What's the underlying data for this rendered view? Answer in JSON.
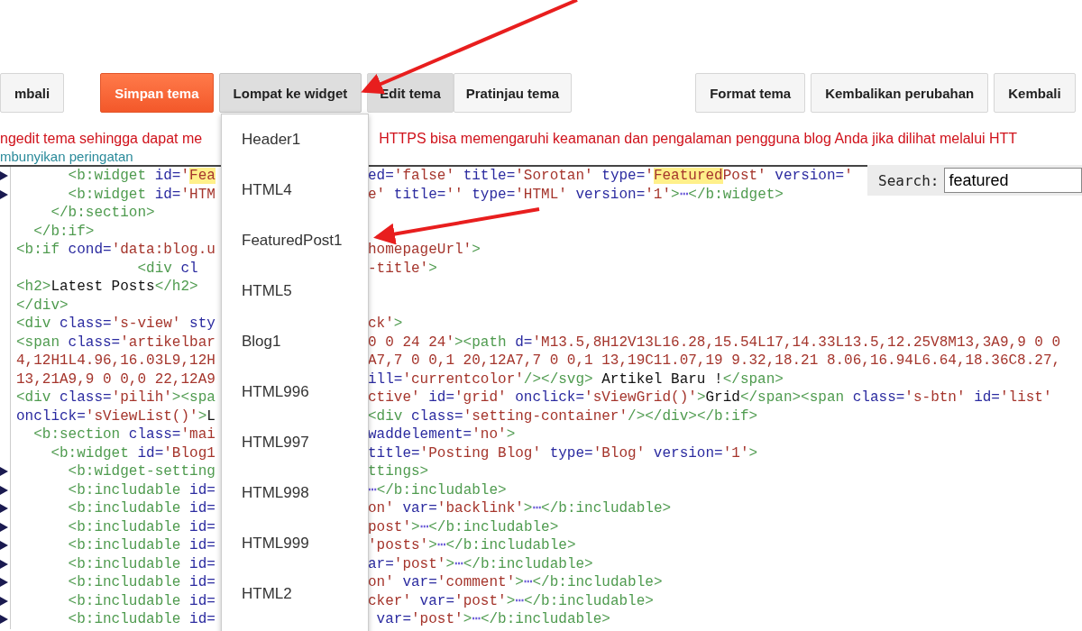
{
  "toolbar": {
    "left": [
      {
        "label": "mbali",
        "kind": "plain"
      },
      {
        "label": "Simpan tema",
        "kind": "primary"
      },
      {
        "label": "Lompat ke widget",
        "kind": "menu",
        "expanded": true
      }
    ],
    "modes": [
      {
        "label": "Edit tema",
        "selected": true
      },
      {
        "label": "Pratinjau tema",
        "selected": false
      }
    ],
    "right": [
      {
        "label": "Format tema",
        "kind": "plain"
      },
      {
        "label": "Kembalikan perubahan",
        "kind": "plain"
      },
      {
        "label": "Kembali",
        "kind": "plain"
      }
    ]
  },
  "warning": {
    "left": "ngedit tema sehingga dapat me",
    "right": "HTTPS bisa memengaruhi keamanan dan pengalaman pengguna blog Anda jika dilihat melalui HTT",
    "link": "mbunyikan peringatan"
  },
  "widget_menu": {
    "items": [
      "Header1",
      "HTML4",
      "FeaturedPost1",
      "HTML5",
      "Blog1",
      "HTML996",
      "HTML997",
      "HTML998",
      "HTML999",
      "HTML2"
    ]
  },
  "editor": {
    "lines": [
      {
        "collapsed": true,
        "left": [
          {
            "kind": "tag",
            "text": "      <b:widget "
          },
          {
            "kind": "attr",
            "text": "id="
          },
          {
            "kind": "str",
            "text": "'"
          },
          {
            "kind": "match",
            "text": "Fea"
          }
        ],
        "right": [
          {
            "kind": "attr",
            "text": "ed="
          },
          {
            "kind": "str",
            "text": "'false'"
          },
          {
            "kind": "attr",
            "text": " title="
          },
          {
            "kind": "str",
            "text": "'Sorotan'"
          },
          {
            "kind": "attr",
            "text": " type="
          },
          {
            "kind": "str",
            "text": "'"
          },
          {
            "kind": "match",
            "text": "Featured"
          },
          {
            "kind": "str",
            "text": "Post'"
          },
          {
            "kind": "attr",
            "text": " version="
          },
          {
            "kind": "str",
            "text": "'"
          }
        ]
      },
      {
        "collapsed": true,
        "left": [
          {
            "kind": "tag",
            "text": "      <b:widget "
          },
          {
            "kind": "attr",
            "text": "id="
          },
          {
            "kind": "str",
            "text": "'HTM"
          }
        ],
        "right": [
          {
            "kind": "str",
            "text": "e'"
          },
          {
            "kind": "attr",
            "text": " title="
          },
          {
            "kind": "str",
            "text": "''"
          },
          {
            "kind": "attr",
            "text": " type="
          },
          {
            "kind": "str",
            "text": "'HTML'"
          },
          {
            "kind": "attr",
            "text": " version="
          },
          {
            "kind": "str",
            "text": "'1'"
          },
          {
            "kind": "tag",
            "text": ">"
          },
          {
            "kind": "dots",
            "text": "⋯"
          },
          {
            "kind": "tag",
            "text": "</b:widget>"
          }
        ]
      },
      {
        "collapsed": false,
        "left": [
          {
            "kind": "tag",
            "text": "    </b:section>"
          }
        ]
      },
      {
        "collapsed": false,
        "left": [
          {
            "kind": "tag",
            "text": "  </b:if>"
          }
        ]
      },
      {
        "collapsed": false,
        "left": [
          {
            "kind": "tag",
            "text": "<b:if "
          },
          {
            "kind": "attr",
            "text": "cond="
          },
          {
            "kind": "str",
            "text": "'data:blog.u"
          }
        ],
        "right": [
          {
            "kind": "str",
            "text": "homepageUrl'"
          },
          {
            "kind": "tag",
            "text": ">"
          }
        ]
      },
      {
        "collapsed": false,
        "left": [
          {
            "kind": "tag",
            "text": "              <div "
          },
          {
            "kind": "attr",
            "text": "cl"
          }
        ],
        "right": [
          {
            "kind": "str",
            "text": "-title'"
          },
          {
            "kind": "tag",
            "text": ">"
          }
        ]
      },
      {
        "collapsed": false,
        "left": [
          {
            "kind": "tag",
            "text": "<h2>"
          },
          {
            "kind": "text",
            "text": "Latest Posts"
          },
          {
            "kind": "tag",
            "text": "</h2>"
          }
        ]
      },
      {
        "collapsed": false,
        "left": [
          {
            "kind": "tag",
            "text": "</div>"
          }
        ]
      },
      {
        "collapsed": false,
        "left": [
          {
            "kind": "tag",
            "text": "<div "
          },
          {
            "kind": "attr",
            "text": "class="
          },
          {
            "kind": "str",
            "text": "'s-view'"
          },
          {
            "kind": "attr",
            "text": " sty"
          }
        ],
        "right": [
          {
            "kind": "str",
            "text": "ck'"
          },
          {
            "kind": "tag",
            "text": ">"
          }
        ]
      },
      {
        "collapsed": false,
        "left": [
          {
            "kind": "tag",
            "text": "<span "
          },
          {
            "kind": "attr",
            "text": "class="
          },
          {
            "kind": "str",
            "text": "'artikelbar"
          }
        ],
        "right": [
          {
            "kind": "str",
            "text": "0 0 24 24'"
          },
          {
            "kind": "tag",
            "text": "><path "
          },
          {
            "kind": "attr",
            "text": "d="
          },
          {
            "kind": "str",
            "text": "'M13.5,8H12V13L16.28,15.54L17,14.33L13.5,12.25V8M13,3A9,9 0 0"
          }
        ]
      },
      {
        "collapsed": false,
        "left": [
          {
            "kind": "str",
            "text": "4,12H1L4.96,16.03L9,12H"
          }
        ],
        "right": [
          {
            "kind": "str",
            "text": "A7,7 0 0,1 20,12A7,7 0 0,1 13,19C11.07,19 9.32,18.21 8.06,16.94L6.64,18.36C8.27,"
          }
        ]
      },
      {
        "collapsed": false,
        "left": [
          {
            "kind": "str",
            "text": "13,21A9,9 0 0,0 22,12A9"
          }
        ],
        "right": [
          {
            "kind": "attr",
            "text": "ill="
          },
          {
            "kind": "str",
            "text": "'currentcolor'"
          },
          {
            "kind": "tag",
            "text": "/></svg>"
          },
          {
            "kind": "text",
            "text": " Artikel Baru !"
          },
          {
            "kind": "tag",
            "text": "</span>"
          }
        ]
      },
      {
        "collapsed": false,
        "left": [
          {
            "kind": "tag",
            "text": "<div "
          },
          {
            "kind": "attr",
            "text": "class="
          },
          {
            "kind": "str",
            "text": "'pilih'"
          },
          {
            "kind": "tag",
            "text": "><spa"
          }
        ],
        "right": [
          {
            "kind": "str",
            "text": "ctive'"
          },
          {
            "kind": "attr",
            "text": " id="
          },
          {
            "kind": "str",
            "text": "'grid'"
          },
          {
            "kind": "attr",
            "text": " onclick="
          },
          {
            "kind": "str",
            "text": "'sViewGrid()'"
          },
          {
            "kind": "tag",
            "text": ">"
          },
          {
            "kind": "text",
            "text": "Grid"
          },
          {
            "kind": "tag",
            "text": "</span><span "
          },
          {
            "kind": "attr",
            "text": "class="
          },
          {
            "kind": "str",
            "text": "'s-btn'"
          },
          {
            "kind": "attr",
            "text": " id="
          },
          {
            "kind": "str",
            "text": "'list'"
          }
        ]
      },
      {
        "collapsed": false,
        "left": [
          {
            "kind": "attr",
            "text": "onclick="
          },
          {
            "kind": "str",
            "text": "'sViewList()'"
          },
          {
            "kind": "tag",
            "text": ">"
          },
          {
            "kind": "text",
            "text": "L"
          }
        ],
        "right": [
          {
            "kind": "tag",
            "text": "<div "
          },
          {
            "kind": "attr",
            "text": "class="
          },
          {
            "kind": "str",
            "text": "'setting-container'"
          },
          {
            "kind": "tag",
            "text": "/></div></b:if>"
          }
        ]
      },
      {
        "collapsed": false,
        "left": [
          {
            "kind": "tag",
            "text": "  <b:section "
          },
          {
            "kind": "attr",
            "text": "class="
          },
          {
            "kind": "str",
            "text": "'mai"
          }
        ],
        "right": [
          {
            "kind": "attr",
            "text": "waddelement="
          },
          {
            "kind": "str",
            "text": "'no'"
          },
          {
            "kind": "tag",
            "text": ">"
          }
        ]
      },
      {
        "collapsed": false,
        "left": [
          {
            "kind": "tag",
            "text": "    <b:widget "
          },
          {
            "kind": "attr",
            "text": "id="
          },
          {
            "kind": "str",
            "text": "'Blog1"
          }
        ],
        "right": [
          {
            "kind": "attr",
            "text": "title="
          },
          {
            "kind": "str",
            "text": "'Posting Blog'"
          },
          {
            "kind": "attr",
            "text": " type="
          },
          {
            "kind": "str",
            "text": "'Blog'"
          },
          {
            "kind": "attr",
            "text": " version="
          },
          {
            "kind": "str",
            "text": "'1'"
          },
          {
            "kind": "tag",
            "text": ">"
          }
        ]
      },
      {
        "collapsed": true,
        "left": [
          {
            "kind": "tag",
            "text": "      <b:widget-setting"
          }
        ],
        "right": [
          {
            "kind": "tag",
            "text": "ttings>"
          }
        ]
      },
      {
        "collapsed": true,
        "left": [
          {
            "kind": "tag",
            "text": "      <b:includable "
          },
          {
            "kind": "attr",
            "text": "id="
          }
        ],
        "right": [
          {
            "kind": "dots",
            "text": "⋯"
          },
          {
            "kind": "tag",
            "text": "</b:includable>"
          }
        ]
      },
      {
        "collapsed": true,
        "left": [
          {
            "kind": "tag",
            "text": "      <b:includable "
          },
          {
            "kind": "attr",
            "text": "id="
          }
        ],
        "right": [
          {
            "kind": "str",
            "text": "on'"
          },
          {
            "kind": "attr",
            "text": " var="
          },
          {
            "kind": "str",
            "text": "'backlink'"
          },
          {
            "kind": "tag",
            "text": ">"
          },
          {
            "kind": "dots",
            "text": "⋯"
          },
          {
            "kind": "tag",
            "text": "</b:includable>"
          }
        ]
      },
      {
        "collapsed": true,
        "left": [
          {
            "kind": "tag",
            "text": "      <b:includable "
          },
          {
            "kind": "attr",
            "text": "id="
          }
        ],
        "right": [
          {
            "kind": "str",
            "text": "post'"
          },
          {
            "kind": "tag",
            "text": ">"
          },
          {
            "kind": "dots",
            "text": "⋯"
          },
          {
            "kind": "tag",
            "text": "</b:includable>"
          }
        ]
      },
      {
        "collapsed": true,
        "left": [
          {
            "kind": "tag",
            "text": "      <b:includable "
          },
          {
            "kind": "attr",
            "text": "id="
          }
        ],
        "right": [
          {
            "kind": "str",
            "text": "'posts'"
          },
          {
            "kind": "tag",
            "text": ">"
          },
          {
            "kind": "dots",
            "text": "⋯"
          },
          {
            "kind": "tag",
            "text": "</b:includable>"
          }
        ]
      },
      {
        "collapsed": true,
        "left": [
          {
            "kind": "tag",
            "text": "      <b:includable "
          },
          {
            "kind": "attr",
            "text": "id="
          }
        ],
        "right": [
          {
            "kind": "attr",
            "text": "ar="
          },
          {
            "kind": "str",
            "text": "'post'"
          },
          {
            "kind": "tag",
            "text": ">"
          },
          {
            "kind": "dots",
            "text": "⋯"
          },
          {
            "kind": "tag",
            "text": "</b:includable>"
          }
        ]
      },
      {
        "collapsed": true,
        "left": [
          {
            "kind": "tag",
            "text": "      <b:includable "
          },
          {
            "kind": "attr",
            "text": "id="
          }
        ],
        "right": [
          {
            "kind": "str",
            "text": "on'"
          },
          {
            "kind": "attr",
            "text": " var="
          },
          {
            "kind": "str",
            "text": "'comment'"
          },
          {
            "kind": "tag",
            "text": ">"
          },
          {
            "kind": "dots",
            "text": "⋯"
          },
          {
            "kind": "tag",
            "text": "</b:includable>"
          }
        ]
      },
      {
        "collapsed": true,
        "left": [
          {
            "kind": "tag",
            "text": "      <b:includable "
          },
          {
            "kind": "attr",
            "text": "id="
          }
        ],
        "right": [
          {
            "kind": "str",
            "text": "cker'"
          },
          {
            "kind": "attr",
            "text": " var="
          },
          {
            "kind": "str",
            "text": "'post'"
          },
          {
            "kind": "tag",
            "text": ">"
          },
          {
            "kind": "dots",
            "text": "⋯"
          },
          {
            "kind": "tag",
            "text": "</b:includable>"
          }
        ]
      },
      {
        "collapsed": true,
        "left": [
          {
            "kind": "tag",
            "text": "      <b:includable "
          },
          {
            "kind": "attr",
            "text": "id="
          }
        ],
        "right": [
          {
            "kind": "attr",
            "text": " var="
          },
          {
            "kind": "str",
            "text": "'post'"
          },
          {
            "kind": "tag",
            "text": ">"
          },
          {
            "kind": "dots",
            "text": "⋯"
          },
          {
            "kind": "tag",
            "text": "</b:includable>"
          }
        ]
      }
    ]
  },
  "search": {
    "label": "Search:",
    "value": "featured"
  }
}
